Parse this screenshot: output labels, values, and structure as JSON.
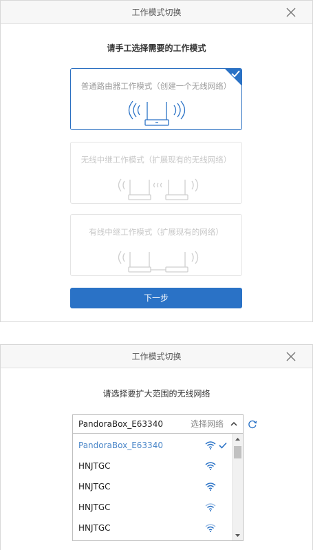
{
  "dialog1": {
    "title": "工作模式切换",
    "heading": "请手工选择需要的工作模式",
    "modes": [
      {
        "label": "普通路由器工作模式（创建一个无线网络）",
        "selected": true
      },
      {
        "label": "无线中继工作模式（扩展现有的无线网络）",
        "selected": false
      },
      {
        "label": "有线中继工作模式（扩展现有的网络）",
        "selected": false
      }
    ],
    "next_label": "下一步"
  },
  "dialog2": {
    "title": "工作模式切换",
    "heading": "请选择要扩大范围的无线网络",
    "selected_network": "PandoraBox_E63340",
    "select_hint": "选择网络",
    "networks": [
      {
        "name": "PandoraBox_E63340",
        "active": true
      },
      {
        "name": "HNJTGC",
        "active": false
      },
      {
        "name": "HNJTGC",
        "active": false
      },
      {
        "name": "HNJTGC",
        "active": false
      },
      {
        "name": "HNJTGC",
        "active": false
      }
    ]
  },
  "colors": {
    "accent": "#2a72c6",
    "selected_border": "#2a6fc1",
    "active_text": "#4a86c8",
    "wifi_icon": "#2a72c6"
  },
  "icons": {
    "close": "close-icon",
    "check": "check-icon",
    "router": "router-icon",
    "wifi": "wifi-icon",
    "refresh": "refresh-icon",
    "caret": "chevron-up-icon"
  }
}
